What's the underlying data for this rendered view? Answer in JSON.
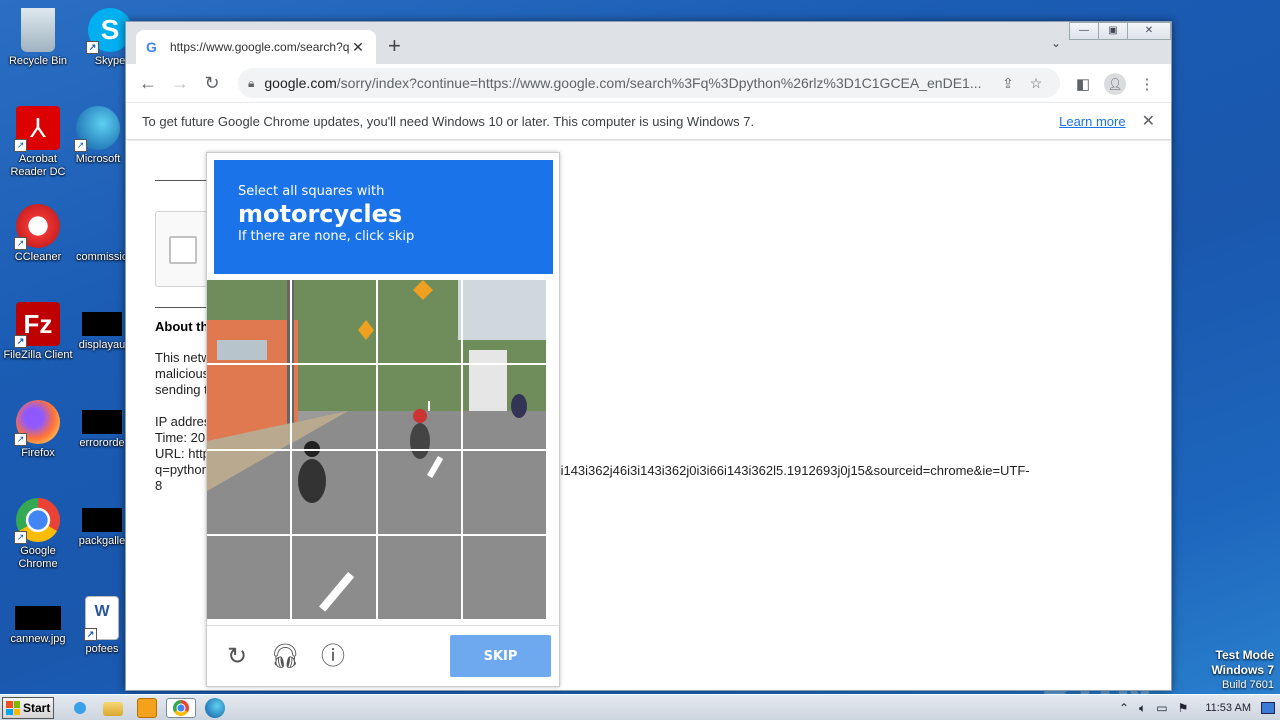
{
  "desktop": {
    "icons": [
      {
        "label": "Recycle Bin",
        "icon": "recycle-bin-icon"
      },
      {
        "label": "Skype",
        "icon": "skype-icon"
      },
      {
        "label": "Acrobat Reader DC",
        "icon": "acrobat-icon"
      },
      {
        "label": "Microsoft",
        "icon": "edge-icon"
      },
      {
        "label": "CCleaner",
        "icon": "ccleaner-icon"
      },
      {
        "label": "commissio",
        "icon": "document-icon"
      },
      {
        "label": "FileZilla Client",
        "icon": "filezilla-icon"
      },
      {
        "label": "displayau",
        "icon": "blank-file-icon"
      },
      {
        "label": "Firefox",
        "icon": "firefox-icon"
      },
      {
        "label": "errororde",
        "icon": "blank-file-icon"
      },
      {
        "label": "Google Chrome",
        "icon": "chrome-icon"
      },
      {
        "label": "packgalle",
        "icon": "blank-file-icon"
      },
      {
        "label": "cannew.jpg",
        "icon": "image-file-icon"
      },
      {
        "label": "pofees",
        "icon": "word-doc-icon"
      }
    ]
  },
  "browser": {
    "tab_title": "https://www.google.com/search?q=",
    "url_host": "google.com",
    "url_rest": "/sorry/index?continue=https://www.google.com/search%3Fq%3Dpython%26rlz%3D1C1GCEA_enDE1...",
    "infobar_message": "To get future Google Chrome updates, you'll need Windows 10 or later. This computer is using Windows 7.",
    "infobar_link": "Learn more"
  },
  "page": {
    "about_heading": "About th",
    "para_lines": [
      "This netw",
      "malicious",
      "sending t"
    ],
    "ip_lines": [
      "IP addres",
      "Time: 20",
      "URL: http",
      "q=python",
      "8"
    ],
    "url_tail": "3i66i143i362j46i3i143i362j0i3i66i143i362l5.1912693j0j15&sourceid=chrome&ie=UTF-"
  },
  "captcha": {
    "instruction_line1": "Select all squares with",
    "target_object": "motorcycles",
    "instruction_line3": "If there are none, click skip",
    "skip_label": "SKIP"
  },
  "watermark": {
    "brand": "ANY RUN",
    "test_mode": "Test Mode",
    "os": "Windows 7",
    "build": "Build 7601"
  },
  "taskbar": {
    "start_label": "Start",
    "clock": "11:53 AM"
  }
}
